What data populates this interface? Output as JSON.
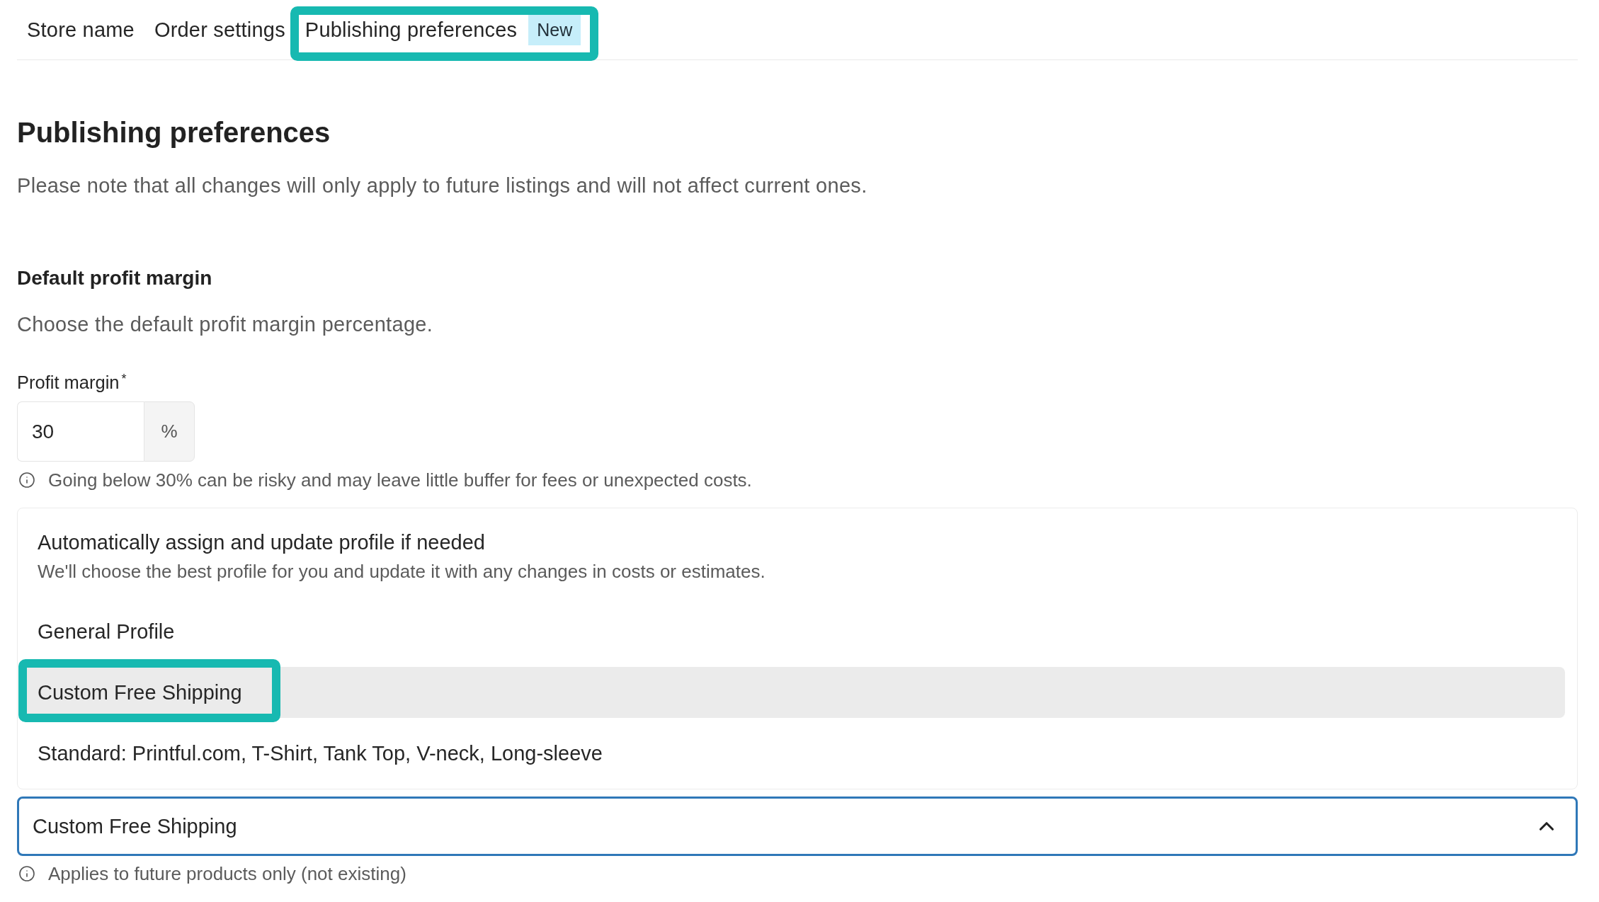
{
  "tabs": [
    {
      "label": "Store name",
      "highlighted": false
    },
    {
      "label": "Order settings",
      "highlighted": false
    },
    {
      "label": "Publishing preferences",
      "badge": "New",
      "highlighted": true
    }
  ],
  "page": {
    "title": "Publishing preferences",
    "note": "Please note that all changes will only apply to future listings and will not affect current ones."
  },
  "profit_margin": {
    "title": "Default profit margin",
    "description": "Choose the default profit margin percentage.",
    "field": {
      "label": "Profit margin",
      "required_mark": "*",
      "value": "30",
      "suffix": "%"
    },
    "hint": "Going below 30% can be risky and may leave little buffer for fees or unexpected costs."
  },
  "shipping_profile": {
    "options": [
      {
        "label": "Automatically assign and update profile if needed",
        "description": "We'll choose the best profile for you and update it with any changes in costs or estimates.",
        "selected": false,
        "highlighted": false
      },
      {
        "label": "General Profile",
        "selected": false,
        "highlighted": false
      },
      {
        "label": "Custom Free Shipping",
        "selected": true,
        "highlighted": true
      },
      {
        "label": "Standard: Printful.com, T-Shirt, Tank Top, V-neck, Long-sleeve",
        "selected": false,
        "highlighted": false
      }
    ],
    "select": {
      "value": "Custom Free Shipping",
      "expanded": true
    },
    "hint": "Applies to future products only (not existing)"
  }
}
